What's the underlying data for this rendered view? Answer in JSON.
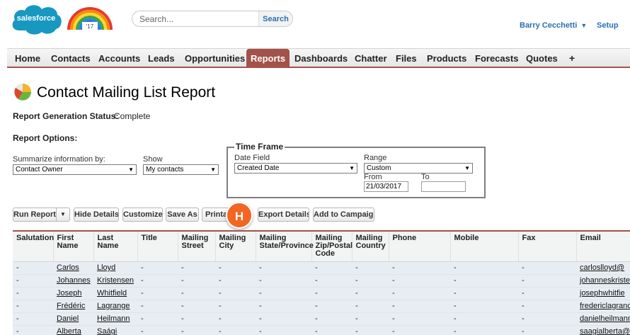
{
  "header": {
    "logo_text": "salesforce",
    "badge_text": "'17",
    "search_placeholder": "Search...",
    "search_button": "Search",
    "user_name": "Barry Cecchetti",
    "setup_label": "Setup",
    "colors": {
      "brand_blue": "#1798c1",
      "tab_active": "#a3524a",
      "link": "#2a6fb0"
    }
  },
  "tabs": [
    "Home",
    "Contacts",
    "Accounts",
    "Leads",
    "Opportunities",
    "Reports",
    "Dashboards",
    "Chatter",
    "Files",
    "Products",
    "Forecasts",
    "Quotes",
    "+"
  ],
  "active_tab": "Reports",
  "page": {
    "title": "Contact Mailing List Report",
    "status_label": "Report Generation Status:",
    "status_value": "Complete",
    "options_label": "Report Options:"
  },
  "options": {
    "summarize_label": "Summarize information by:",
    "summarize_value": "Contact Owner",
    "show_label": "Show",
    "show_value": "My contacts",
    "timeframe": {
      "legend": "Time Frame",
      "date_field_label": "Date Field",
      "date_field_value": "Created Date",
      "range_label": "Range",
      "range_value": "Custom",
      "from_label": "From",
      "from_value": "21/03/2017",
      "to_label": "To",
      "to_value": ""
    }
  },
  "buttons": {
    "run_report": "Run Report",
    "hide_details": "Hide Details",
    "customize": "Customize",
    "save_as": "Save As",
    "printable": "Printa",
    "export_details": "Export Details",
    "add_to_campaign": "Add to Campaign"
  },
  "callout": "H",
  "table": {
    "columns": [
      "Salutation",
      "First Name",
      "Last Name",
      "Title",
      "Mailing Street",
      "Mailing City",
      "Mailing State/Province",
      "Mailing Zip/Postal Code",
      "Mailing Country",
      "Phone",
      "Mobile",
      "Fax",
      "Email"
    ],
    "rows": [
      [
        "-",
        "Carlos",
        "Lloyd",
        "-",
        "-",
        "-",
        "-",
        "-",
        "-",
        "-",
        "-",
        "-",
        "carloslloyd@"
      ],
      [
        "-",
        "Johannes",
        "Kristensen",
        "-",
        "-",
        "-",
        "-",
        "-",
        "-",
        "-",
        "-",
        "-",
        "johanneskriste"
      ],
      [
        "-",
        "Joseph",
        "Whitfield",
        "-",
        "-",
        "-",
        "-",
        "-",
        "-",
        "-",
        "-",
        "-",
        "josephwhitfie"
      ],
      [
        "-",
        "Frédéric",
        "Lagrange",
        "-",
        "-",
        "-",
        "-",
        "-",
        "-",
        "-",
        "-",
        "-",
        "fredericlagranc"
      ],
      [
        "-",
        "Daniel",
        "Heilmann",
        "-",
        "-",
        "-",
        "-",
        "-",
        "-",
        "-",
        "-",
        "-",
        "danielheilmann"
      ],
      [
        "-",
        "Alberta",
        "Saági",
        "-",
        "-",
        "-",
        "-",
        "-",
        "-",
        "-",
        "-",
        "-",
        "saagialberta@"
      ]
    ]
  }
}
